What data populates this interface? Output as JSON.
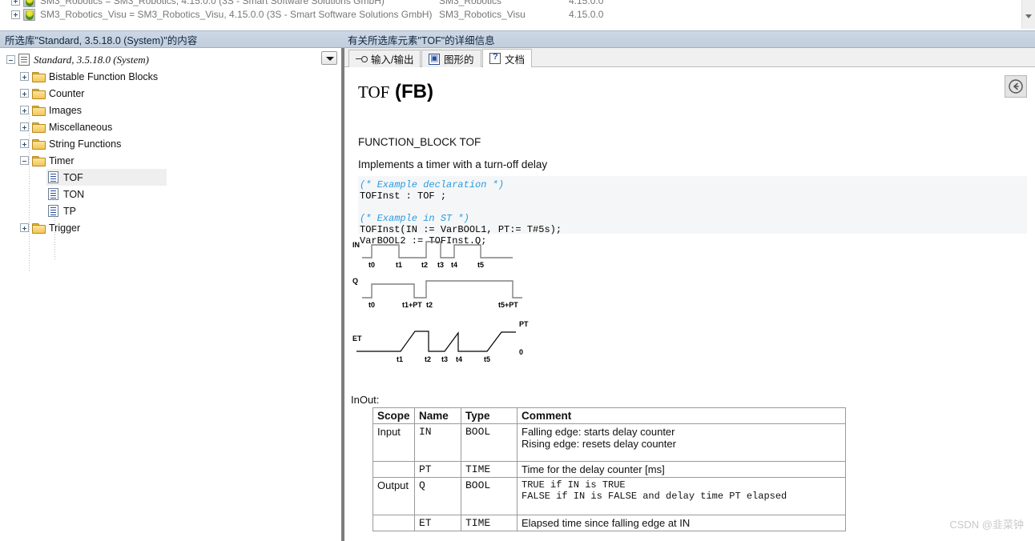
{
  "top_list": {
    "rows": [
      {
        "name": "SM3_Robotics = SM3_Robotics, 4.15.0.0 (3S - Smart Software Solutions GmbH)",
        "col2": "SM3_Robotics",
        "col3": "4.15.0.0"
      },
      {
        "name": "SM3_Robotics_Visu = SM3_Robotics_Visu, 4.15.0.0 (3S - Smart Software Solutions GmbH)",
        "col2": "SM3_Robotics_Visu",
        "col3": "4.15.0.0"
      }
    ]
  },
  "headers": {
    "left": "所选库\"Standard, 3.5.18.0 (System)\"的内容",
    "right": "有关所选库元素\"TOF\"的详细信息"
  },
  "tree": {
    "root": "Standard, 3.5.18.0 (System)",
    "nodes": [
      {
        "label": "Bistable Function Blocks",
        "type": "folder",
        "state": "collapsed"
      },
      {
        "label": "Counter",
        "type": "folder",
        "state": "collapsed"
      },
      {
        "label": "Images",
        "type": "folder",
        "state": "collapsed"
      },
      {
        "label": "Miscellaneous",
        "type": "folder",
        "state": "collapsed"
      },
      {
        "label": "String Functions",
        "type": "folder",
        "state": "collapsed"
      },
      {
        "label": "Timer",
        "type": "folder",
        "state": "expanded"
      },
      {
        "label": "TOF",
        "type": "doc",
        "state": "selected"
      },
      {
        "label": "TON",
        "type": "doc",
        "state": "normal"
      },
      {
        "label": "TP",
        "type": "doc",
        "state": "normal"
      },
      {
        "label": "Trigger",
        "type": "folder",
        "state": "collapsed"
      }
    ]
  },
  "tabs": [
    {
      "label": "输入/输出",
      "icon": "io-icon",
      "active": false
    },
    {
      "label": "图形的",
      "icon": "graph-icon",
      "active": false
    },
    {
      "label": "文档",
      "icon": "help-icon",
      "active": true
    }
  ],
  "doc": {
    "title_name": "TOF",
    "title_kind": "(FB)",
    "function_block": "FUNCTION_BLOCK TOF",
    "description": "Implements a timer with a turn-off delay",
    "code": {
      "line1": "(* Example declaration *)",
      "line2": "TOFInst : TOF ;",
      "line3": "",
      "line4": "(* Example in ST *)",
      "line5": "TOFInst(IN := VarBOOL1, PT:= T#5s);",
      "line6": "VarBOOL2 := TOFInst.Q;"
    },
    "timing": {
      "rows": [
        {
          "name": "IN",
          "ticks": [
            "t0",
            "t1",
            "t2",
            "t3",
            "t4",
            "t5"
          ]
        },
        {
          "name": "Q",
          "ticks": [
            "t0",
            "t1+PT",
            "t2",
            "t5+PT"
          ]
        },
        {
          "name": "ET",
          "ticks": [
            "t1",
            "t2",
            "t3",
            "t4",
            "t5"
          ],
          "top_label": "PT",
          "bottom_label": "0"
        }
      ]
    },
    "inout_label": "InOut:",
    "table": {
      "columns": [
        "Scope",
        "Name",
        "Type",
        "Comment"
      ],
      "rows": [
        {
          "scope": "Input",
          "name": "IN",
          "type": "BOOL",
          "comment_lines": [
            "Falling edge: starts delay counter",
            "Rising edge: resets delay counter"
          ]
        },
        {
          "scope": "",
          "name": "PT",
          "type": "TIME",
          "comment_lines": [
            "Time for the delay counter [ms]"
          ]
        },
        {
          "scope": "Output",
          "name": "Q",
          "type": "BOOL",
          "comment_lines": [
            "TRUE if IN is TRUE",
            "FALSE if IN is FALSE and delay time PT elapsed"
          ]
        },
        {
          "scope": "",
          "name": "ET",
          "type": "TIME",
          "comment_lines": [
            "Elapsed time since falling edge at IN"
          ]
        }
      ]
    },
    "back_button": "返回"
  },
  "watermark": "CSDN @韭菜钟",
  "colors": {
    "header_bar": "#c8d3e2",
    "code_bg": "#f5f6f7",
    "comment_blue": "#2a9ce0",
    "selection": "#efefef"
  }
}
